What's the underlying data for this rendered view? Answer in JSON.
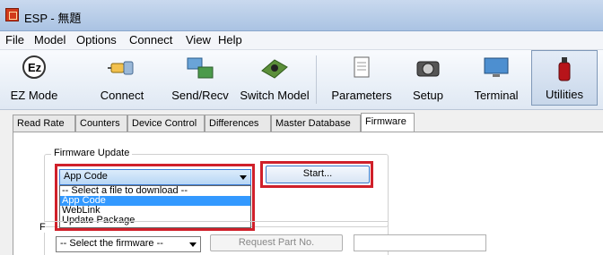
{
  "window": {
    "title": "ESP - 無題"
  },
  "menu": [
    "File",
    "Model",
    "Options",
    "Connect",
    "View",
    "Help"
  ],
  "toolbar": {
    "buttons": [
      {
        "label": "EZ Mode",
        "icon": "ez-icon"
      },
      {
        "label": "Connect",
        "icon": "plug-icon"
      },
      {
        "label": "Send/Recv",
        "icon": "computer-transfer-icon"
      },
      {
        "label": "Switch Model",
        "icon": "device-icon"
      },
      {
        "label": "Parameters",
        "icon": "document-icon"
      },
      {
        "label": "Setup",
        "icon": "camera-icon"
      },
      {
        "label": "Terminal",
        "icon": "monitor-icon"
      },
      {
        "label": "Utilities",
        "icon": "fire-extinguisher-icon",
        "active": true
      }
    ]
  },
  "tabs": [
    {
      "label": "Read Rate"
    },
    {
      "label": "Counters"
    },
    {
      "label": "Device Control"
    },
    {
      "label": "Differences"
    },
    {
      "label": "Master Database"
    },
    {
      "label": "Firmware",
      "active": true
    }
  ],
  "firmware_update": {
    "group_title": "Firmware Update",
    "file_select_value": "App Code",
    "dropdown_options": [
      "-- Select a file to download --",
      "App Code",
      "WebLink",
      "Update Package"
    ],
    "selected_option_index": 1,
    "start_label": "Start..."
  },
  "firmware_part": {
    "group_fragment": "F",
    "select_value": "-- Select the firmware --",
    "request_label": "Request Part No.",
    "part_no_value": ""
  },
  "colors": {
    "highlight": "#d0202a",
    "selection": "#3399ff"
  }
}
